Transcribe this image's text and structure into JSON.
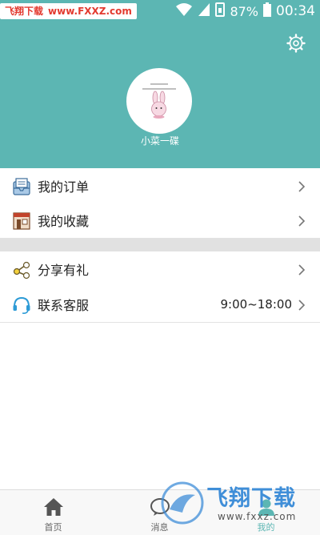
{
  "status_bar": {
    "watermark_name": "飞翔下载",
    "watermark_url": "www.FXXZ.com",
    "battery": "87%",
    "time": "00:34"
  },
  "profile": {
    "username": "小菜一碟"
  },
  "menu": {
    "items": [
      {
        "label": "我的订单",
        "icon": "orders-icon"
      },
      {
        "label": "我的收藏",
        "icon": "favorites-icon"
      },
      {
        "label": "分享有礼",
        "icon": "share-icon"
      },
      {
        "label": "联系客服",
        "icon": "headset-icon",
        "extra": "9:00~18:00"
      }
    ]
  },
  "bottom_nav": {
    "items": [
      {
        "label": "首页",
        "icon": "home-icon"
      },
      {
        "label": "消息",
        "icon": "message-icon"
      },
      {
        "label": "我的",
        "icon": "profile-icon",
        "active": true
      }
    ]
  },
  "watermark": {
    "name": "飞翔下载",
    "url": "www.fxxz.com"
  },
  "colors": {
    "accent": "#5cb6b3",
    "divider": "#e1e1e1"
  }
}
